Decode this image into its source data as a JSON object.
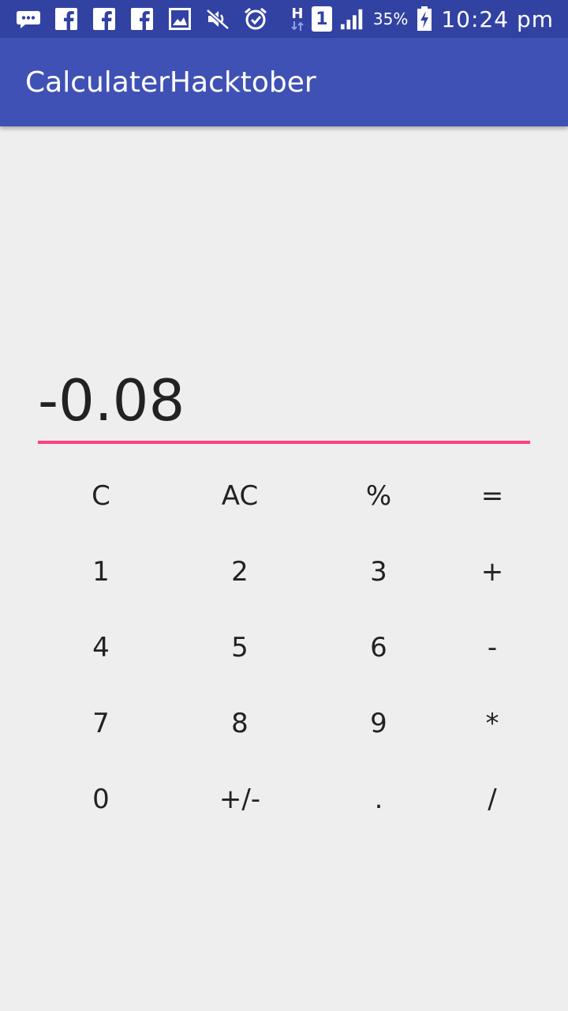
{
  "status_bar": {
    "signal_text": "H",
    "sim_slot": "1",
    "battery_percent": "35%",
    "time": "10:24 pm",
    "icons": [
      "messages-icon",
      "facebook-icon",
      "facebook-icon",
      "facebook-icon",
      "gallery-icon",
      "mute-icon",
      "alarm-icon",
      "data-hplus-icon",
      "sim-1-icon",
      "signal-icon",
      "battery-charging-icon"
    ]
  },
  "app_bar": {
    "title": "CalculaterHacktober",
    "color": "#3f51b5"
  },
  "display": {
    "value": "-0.08",
    "underline_color": "#ff4081"
  },
  "keypad": {
    "rows": [
      [
        "C",
        "AC",
        "%",
        "="
      ],
      [
        "1",
        "2",
        "3",
        "+"
      ],
      [
        "4",
        "5",
        "6",
        "-"
      ],
      [
        "7",
        "8",
        "9",
        "*"
      ],
      [
        "0",
        "+/-",
        ".",
        "/"
      ]
    ]
  }
}
